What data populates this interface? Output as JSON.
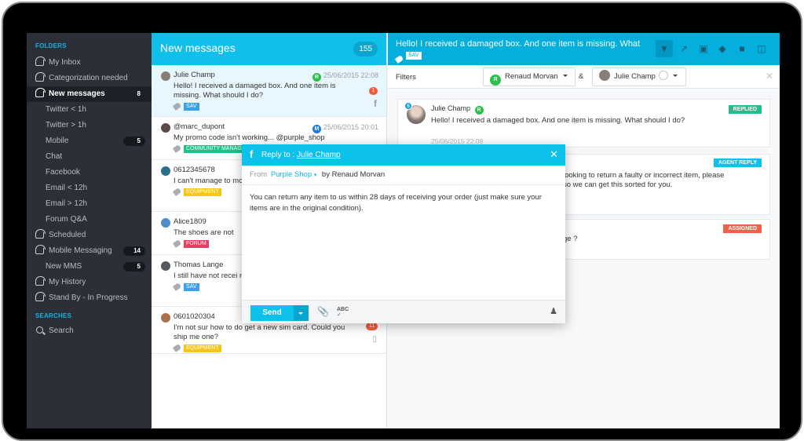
{
  "sidebar": {
    "folders_label": "FOLDERS",
    "items": [
      {
        "label": "My Inbox",
        "icon": "inbox-icon",
        "badge": null,
        "sub": false,
        "active": false
      },
      {
        "label": "Categorization needed",
        "icon": "inbox-icon",
        "badge": null,
        "sub": false,
        "active": false
      },
      {
        "label": "New messages",
        "icon": "inbox-icon",
        "badge": "8",
        "sub": false,
        "active": true
      },
      {
        "label": "Twitter < 1h",
        "icon": null,
        "badge": null,
        "sub": true,
        "active": false
      },
      {
        "label": "Twitter > 1h",
        "icon": null,
        "badge": null,
        "sub": true,
        "active": false
      },
      {
        "label": "Mobile",
        "icon": null,
        "badge": "5",
        "sub": true,
        "active": false
      },
      {
        "label": "Chat",
        "icon": null,
        "badge": null,
        "sub": true,
        "active": false
      },
      {
        "label": "Facebook",
        "icon": null,
        "badge": null,
        "sub": true,
        "active": false
      },
      {
        "label": "Email < 12h",
        "icon": null,
        "badge": null,
        "sub": true,
        "active": false
      },
      {
        "label": "Email > 12h",
        "icon": null,
        "badge": null,
        "sub": true,
        "active": false
      },
      {
        "label": "Forum Q&A",
        "icon": null,
        "badge": null,
        "sub": true,
        "active": false
      },
      {
        "label": "Scheduled",
        "icon": "inbox-icon",
        "badge": null,
        "sub": false,
        "active": false
      },
      {
        "label": "Mobile Messaging",
        "icon": "inbox-icon",
        "badge": "14",
        "sub": false,
        "active": false
      },
      {
        "label": "New MMS",
        "icon": null,
        "badge": "5",
        "sub": true,
        "active": false
      },
      {
        "label": "My History",
        "icon": "inbox-icon",
        "badge": null,
        "sub": false,
        "active": false
      },
      {
        "label": "Stand By - In Progress",
        "icon": "inbox-icon",
        "badge": null,
        "sub": false,
        "active": false
      }
    ],
    "searches_label": "SEARCHES",
    "search_label": "Search"
  },
  "list": {
    "title": "New messages",
    "count": "155",
    "messages": [
      {
        "author": "Julie Champ",
        "agent": "R",
        "agent_color": "#2bc04b",
        "date": "25/06/2015 22:08",
        "text": "Hello! I received a damaged box. And one item is missing. What should I do?",
        "tag": "SAV",
        "tag_color": "#3aa0ea",
        "unread": "1",
        "channel": "f",
        "avatar_color": "#8a7d76"
      },
      {
        "author": "@marc_dupont",
        "agent": "M",
        "agent_color": "#1b7ae0",
        "date": "25/06/2015 20:01",
        "text": "My promo code isn't working... @purple_shop",
        "tag": "COMMUNITY MANAG",
        "tag_color": "#1fc08a",
        "unread": null,
        "channel": null,
        "avatar_color": "#5a4c45"
      },
      {
        "author": "0612345678",
        "agent": null,
        "agent_color": null,
        "date": null,
        "text": "I can't manage to mobile version.",
        "tag": "EQUIPMENT",
        "tag_color": "#f5c518",
        "unread": null,
        "channel": null,
        "avatar_color": "#2c6f8a"
      },
      {
        "author": "Alice1809",
        "agent": null,
        "agent_color": null,
        "date": null,
        "text": "The shoes are not",
        "tag": "FORUM",
        "tag_color": "#e83e63",
        "unread": null,
        "channel": null,
        "avatar_color": "#4d8ec4"
      },
      {
        "author": "Thomas Lange",
        "agent": null,
        "agent_color": null,
        "date": null,
        "text": "I still have not recei mobile phone",
        "tag": "SAV",
        "tag_color": "#3aa0ea",
        "unread": null,
        "channel": null,
        "avatar_color": "#55585e"
      },
      {
        "author": "0601020304",
        "agent": null,
        "agent_color": null,
        "date": null,
        "text": "I'm not sur how to do get a new sim card. Could you ship me one?",
        "tag": "EQUIPMENT",
        "tag_color": "#f5c518",
        "unread": "11",
        "channel": "mobile",
        "avatar_color": "#a9704e"
      }
    ]
  },
  "detail": {
    "title": "Hello! I received a damaged box. And one item is missing. What",
    "tag": "SAV",
    "tools": [
      "filter-icon",
      "open-external-icon",
      "id-card-icon",
      "tag-icon",
      "archive-icon",
      "trash-icon"
    ],
    "filters_label": "Filters",
    "filter_agent": {
      "initial": "R",
      "name": "Renaud Morvan"
    },
    "filter_amp": "&",
    "filter_customer": {
      "name": "Julie Champ"
    },
    "cards": [
      {
        "author": "Julie Champ",
        "agent": "R",
        "count": "5",
        "text": "Hello! I received a damaged box. And one item is missing. What should I do?",
        "date": "25/06/2015 22:08",
        "status": "REPLIED",
        "status_color": "#1fc08a"
      },
      {
        "text1": "looking to return a faulty or incorrect item, please",
        "text2": "so we can get this sorted for you.",
        "status": "AGENT REPLY",
        "status_color": "#0cc1ea"
      },
      {
        "text1": "ge ?",
        "status": "ASSIGNED",
        "status_color": "#f26147"
      }
    ]
  },
  "reply": {
    "to_label": "Reply to :",
    "to_name": "Julie Champ",
    "from_label": "From",
    "from_shop": "Purple Shop",
    "by_label": "by Renaud Morvan",
    "body": "You can return any item to us within 28 days of receiving your order (just make sure your items are in the original condition).",
    "send_label": "Send"
  }
}
